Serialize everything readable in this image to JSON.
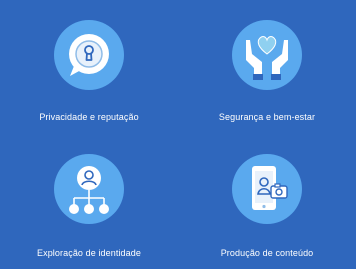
{
  "tiles": [
    {
      "label": "Privacidade e reputação",
      "icon": "speech-bubble-lock-icon"
    },
    {
      "label": "Segurança e bem-estar",
      "icon": "hands-heart-icon"
    },
    {
      "label": "Exploração de identidade",
      "icon": "person-network-icon"
    },
    {
      "label": "Produção de conteúdo",
      "icon": "phone-camera-icon"
    }
  ],
  "colors": {
    "background": "#2f67bd",
    "icon_circle": "#5aa9ee",
    "icon_light": "#e8f1fb",
    "text": "#ffffff"
  }
}
